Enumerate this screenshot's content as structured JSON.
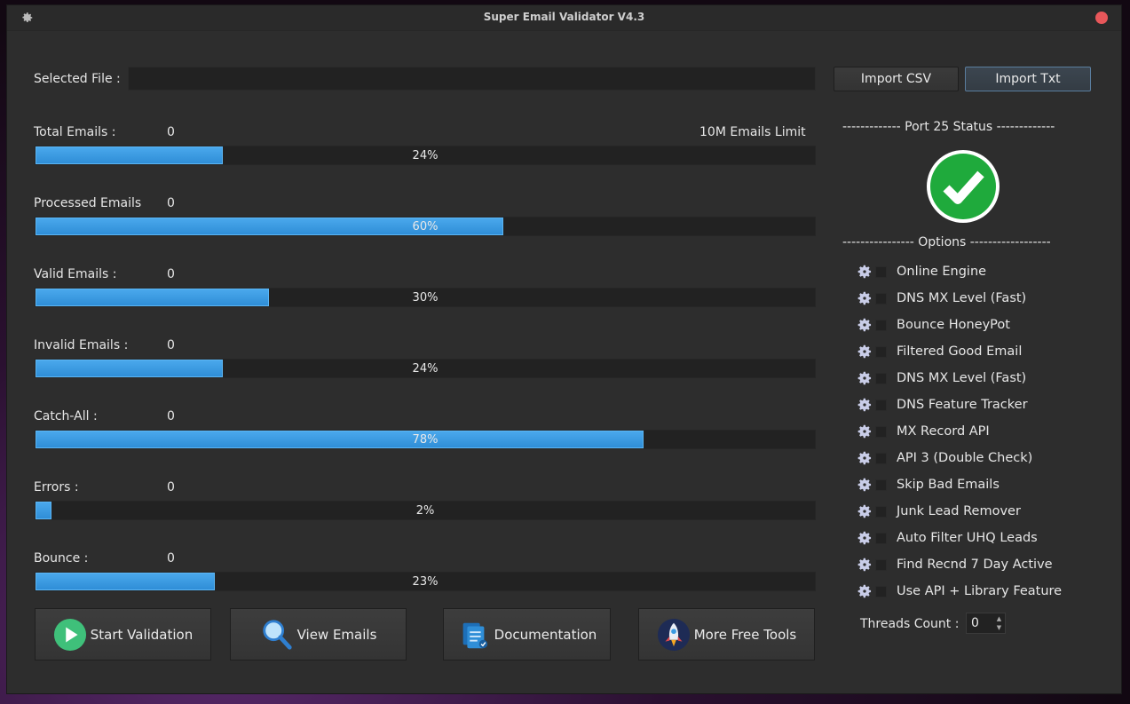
{
  "window": {
    "title": "Super Email Validator  V4.3"
  },
  "file": {
    "label": "Selected File :",
    "value": ""
  },
  "import": {
    "csv": "Import CSV",
    "txt": "Import Txt"
  },
  "limit_text": "10M Emails Limit",
  "stats": [
    {
      "label": "Total Emails :",
      "count": "0",
      "progress": 24,
      "pct_text": "24%"
    },
    {
      "label": "Processed Emails",
      "count": "0",
      "progress": 60,
      "pct_text": "60%"
    },
    {
      "label": "Valid Emails :",
      "count": "0",
      "progress": 30,
      "pct_text": "30%"
    },
    {
      "label": "Invalid Emails :",
      "count": "0",
      "progress": 24,
      "pct_text": "24%"
    },
    {
      "label": "Catch-All :",
      "count": "0",
      "progress": 78,
      "pct_text": "78%"
    },
    {
      "label": "Errors :",
      "count": "0",
      "progress": 2,
      "pct_text": "2%"
    },
    {
      "label": "Bounce :",
      "count": "0",
      "progress": 23,
      "pct_text": "23%"
    }
  ],
  "port": {
    "heading": "-------------  Port 25 Status -------------",
    "status_icon": "check-circle-icon",
    "status_color": "#1faa3c"
  },
  "options": {
    "heading": "----------------  Options ------------------",
    "items": [
      "Online Engine",
      "DNS MX Level (Fast)",
      "Bounce  HoneyPot",
      "Filtered Good Email",
      "DNS MX Level (Fast)",
      "DNS Feature Tracker",
      "MX Record API",
      "API 3 (Double Check)",
      "Skip Bad Emails",
      "Junk Lead Remover",
      "Auto Filter UHQ Leads",
      "Find Recnd 7 Day Active",
      "Use API + Library Feature"
    ]
  },
  "threads": {
    "label": "Threads Count :",
    "value": "0"
  },
  "actions": {
    "start": "Start Validation",
    "view": "View Emails",
    "docs": "Documentation",
    "tools": "More Free Tools"
  },
  "colors": {
    "progress_fill": "#3a9ae2",
    "accent_button_border": "#5a7d9e",
    "close": "#e8575a"
  }
}
